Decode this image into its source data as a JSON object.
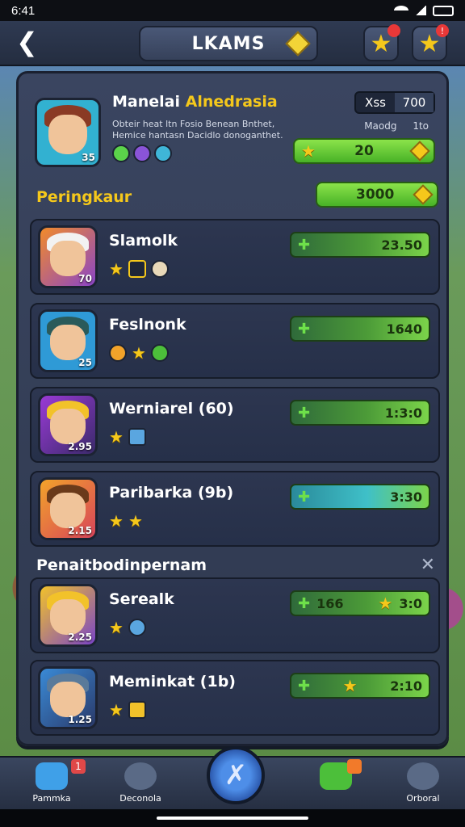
{
  "status": {
    "time": "6:41"
  },
  "header": {
    "title": "LKAMS",
    "back_icon": "back-arrow-icon",
    "notif_badge": "!"
  },
  "profile": {
    "name_main": "Manelai",
    "name_sub": "Alnedrasia",
    "desc_line1": "Obteir heat ltn Fosio Benean Bnthet,",
    "desc_line2": "Hemice hantasn Dacidlo donoganthet.",
    "xp_label": "Xss",
    "xp_value": "700",
    "sub_label": "Maodg",
    "sub_value": "1to",
    "bar_value": "20",
    "level": "35"
  },
  "ranking": {
    "title": "Peringkaur",
    "value": "3000"
  },
  "rows": [
    {
      "name": "Slamolk",
      "value": "23.50",
      "level": "70"
    },
    {
      "name": "Feslnonk",
      "value": "1640",
      "level": "25"
    },
    {
      "name": "Werniarel (60)",
      "value": "1:3:0",
      "level": "2.95"
    },
    {
      "name": "Paribarka (9b)",
      "value": "3:30",
      "level": "2.15"
    }
  ],
  "section2": {
    "title": "Penaitbodinpernam"
  },
  "rows2": [
    {
      "name": "Serealk",
      "value1": "166",
      "value2": "3:0",
      "level": "2.25"
    },
    {
      "name": "Meminkat (1b)",
      "value": "2:10",
      "level": "1.25"
    }
  ],
  "nav": [
    {
      "label": "Pammka",
      "badge": "1"
    },
    {
      "label": "Deconola"
    },
    {
      "label": ""
    },
    {
      "label": "Orboral"
    }
  ],
  "colors": {
    "accent": "#f5c81b",
    "green": "#48b227",
    "panel": "#2f394f"
  }
}
